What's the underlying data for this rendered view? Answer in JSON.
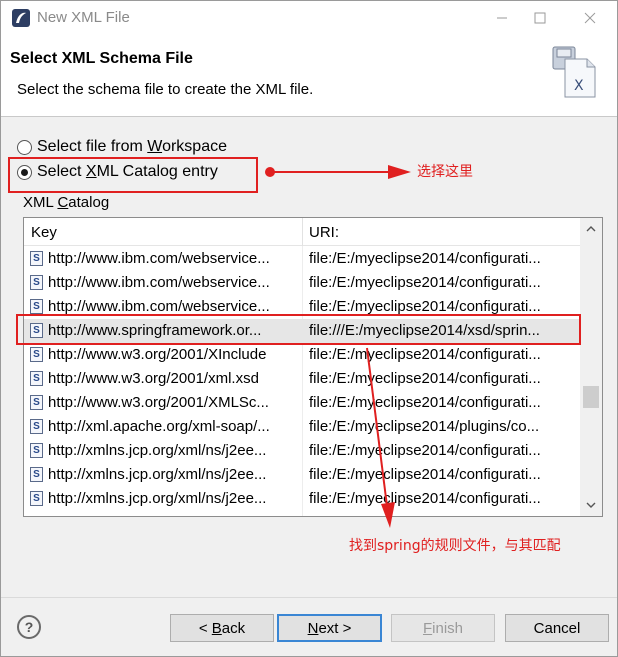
{
  "window": {
    "title": "New XML File"
  },
  "header": {
    "title": "Select XML Schema File",
    "description": "Select the schema file to create the XML file."
  },
  "options": {
    "workspace": {
      "pre": "Select file from ",
      "u": "W",
      "post": "orkspace"
    },
    "catalog": {
      "pre": "Select ",
      "u": "X",
      "post": "ML Catalog entry"
    }
  },
  "annotations": {
    "choose_here": "选择这里",
    "find_spring": "找到spring的规则文件，与其匹配"
  },
  "catalog": {
    "label_u": "C",
    "label_pre": "XML ",
    "label_post": "atalog",
    "columns": {
      "key": "Key",
      "uri": "URI:"
    },
    "rows": [
      {
        "key": "http://www.ibm.com/webservice...",
        "uri": "file:/E:/myeclipse2014/configurati..."
      },
      {
        "key": "http://www.ibm.com/webservice...",
        "uri": "file:/E:/myeclipse2014/configurati..."
      },
      {
        "key": "http://www.ibm.com/webservice...",
        "uri": "file:/E:/myeclipse2014/configurati..."
      },
      {
        "key": "http://www.springframework.or...",
        "uri": "file:///E:/myeclipse2014/xsd/sprin..."
      },
      {
        "key": "http://www.w3.org/2001/XInclude",
        "uri": "file:/E:/myeclipse2014/configurati..."
      },
      {
        "key": "http://www.w3.org/2001/xml.xsd",
        "uri": "file:/E:/myeclipse2014/configurati..."
      },
      {
        "key": "http://www.w3.org/2001/XMLSc...",
        "uri": "file:/E:/myeclipse2014/configurati..."
      },
      {
        "key": "http://xml.apache.org/xml-soap/...",
        "uri": "file:/E:/myeclipse2014/plugins/co..."
      },
      {
        "key": "http://xmlns.jcp.org/xml/ns/j2ee...",
        "uri": "file:/E:/myeclipse2014/configurati..."
      },
      {
        "key": "http://xmlns.jcp.org/xml/ns/j2ee...",
        "uri": "file:/E:/myeclipse2014/configurati..."
      },
      {
        "key": "http://xmlns.jcp.org/xml/ns/j2ee...",
        "uri": "file:/E:/myeclipse2014/configurati..."
      }
    ]
  },
  "buttons": {
    "help": "?",
    "back": {
      "pre": "< ",
      "u": "B",
      "post": "ack"
    },
    "next": {
      "pre": "",
      "u": "N",
      "post": "ext >"
    },
    "finish": {
      "pre": "",
      "u": "F",
      "post": "inish"
    },
    "cancel": "Cancel"
  },
  "colors": {
    "annotation": "#e02020",
    "default_button_border": "#3a86d4",
    "selected_row": "#e6e6e6"
  },
  "icons": {
    "app": "eclipse-icon",
    "header": "xml-file-icon",
    "row": "schema-file-icon"
  }
}
